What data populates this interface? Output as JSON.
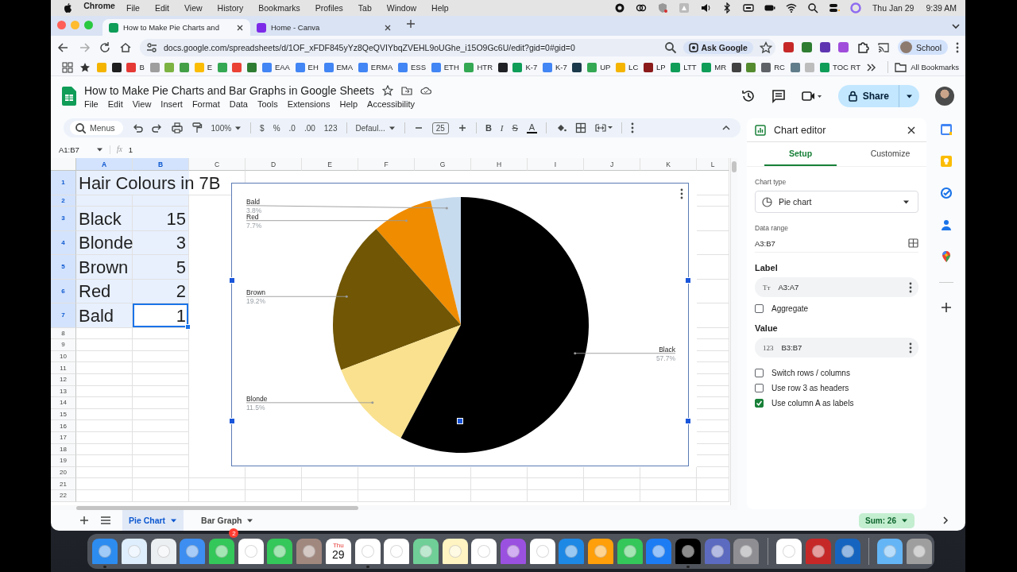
{
  "menubar": {
    "app": "Chrome",
    "items": [
      "File",
      "Edit",
      "View",
      "History",
      "Bookmarks",
      "Profiles",
      "Tab",
      "Window",
      "Help"
    ],
    "date": "Thu Jan 29",
    "time": "9:39 AM"
  },
  "browser_tabs": [
    {
      "title": "How to Make Pie Charts and",
      "selected": true,
      "color": "#0f9d58"
    },
    {
      "title": "Home - Canva",
      "selected": false,
      "color": "#7d2ae8"
    }
  ],
  "address_bar": {
    "url": "docs.google.com/spreadsheets/d/1OF_xFDF845yYz8QeQVIYbqZVEHL9oUGhe_i15O9Gc6U/edit?gid=0#gid=0",
    "ask": "Ask Google",
    "profile": "School",
    "extensions": [
      {
        "color": "#c62828"
      },
      {
        "color": "#2e7d32"
      },
      {
        "color": "#5e35b1"
      },
      {
        "color": "#a04ddb"
      }
    ]
  },
  "bookmarks": {
    "items": [
      {
        "color": "#f4b400"
      },
      {
        "color": "#1f1f1f"
      },
      {
        "label": "B",
        "color": "#e53935"
      },
      {
        "color": "#9e9e9e"
      },
      {
        "color": "#7cb342"
      },
      {
        "color": "#43a047"
      },
      {
        "label": "E",
        "color": "#fbbc04"
      },
      {
        "color": "#34a853"
      },
      {
        "color": "#ea4335"
      },
      {
        "color": "#2e7d32"
      },
      {
        "label": "EAA",
        "color": "#4285f4"
      },
      {
        "label": "EH",
        "color": "#4285f4"
      },
      {
        "label": "EMA",
        "color": "#4285f4"
      },
      {
        "label": "ERMA",
        "color": "#4285f4"
      },
      {
        "label": "ESS",
        "color": "#4285f4"
      },
      {
        "label": "ETH",
        "color": "#4285f4"
      },
      {
        "label": "HTR",
        "color": "#34a853"
      },
      {
        "color": "#202124"
      },
      {
        "label": "K-7",
        "color": "#0f9d58"
      },
      {
        "label": "K-7",
        "color": "#4285f4"
      },
      {
        "color": "#1b3a4b"
      },
      {
        "label": "UP",
        "color": "#34a853"
      },
      {
        "label": "LC",
        "color": "#f4b400"
      },
      {
        "label": "LP",
        "color": "#8b1a1a"
      },
      {
        "label": "LTT",
        "color": "#0f9d58"
      },
      {
        "label": "MR",
        "color": "#0f9d58"
      },
      {
        "color": "#424242"
      },
      {
        "color": "#558b2f"
      },
      {
        "label": "RC",
        "color": "#5f6368"
      },
      {
        "color": "#607d8b"
      },
      {
        "color": "#bdbdbd"
      },
      {
        "label": "TOC RT",
        "color": "#0f9d58"
      }
    ],
    "all": "All Bookmarks"
  },
  "doc": {
    "title": "How to Make Pie Charts and Bar Graphs in Google Sheets",
    "menus": [
      "File",
      "Edit",
      "View",
      "Insert",
      "Format",
      "Data",
      "Tools",
      "Extensions",
      "Help",
      "Accessibility"
    ],
    "share": "Share"
  },
  "toolbar": {
    "search": "Menus",
    "zoom": "100%",
    "currency": "$",
    "percent": "%",
    "decrease_decimals": ".0",
    "increase_decimals": ".00",
    "number_format": "123",
    "font": "Defaul...",
    "font_size": "25",
    "bold": "B",
    "italic": "I",
    "strikethrough": "S",
    "text_color": "A"
  },
  "formula_bar": {
    "name_box": "A1:B7",
    "fx": "fx",
    "value": "1"
  },
  "grid": {
    "columns": [
      {
        "label": "A",
        "selected": true
      },
      {
        "label": "B",
        "selected": true
      },
      {
        "label": "C",
        "selected": false
      },
      {
        "label": "D",
        "selected": false
      },
      {
        "label": "E",
        "selected": false
      },
      {
        "label": "F",
        "selected": false
      },
      {
        "label": "G",
        "selected": false
      },
      {
        "label": "H",
        "selected": false
      },
      {
        "label": "I",
        "selected": false
      },
      {
        "label": "J",
        "selected": false
      },
      {
        "label": "K",
        "selected": false
      },
      {
        "label": "L",
        "selected": false
      }
    ],
    "rows": [
      {
        "label": "1",
        "selected": true,
        "cells": [
          {
            "text": "Hair Colours in 7B",
            "active": false
          }
        ]
      },
      {
        "label": "2",
        "selected": true
      },
      {
        "label": "3",
        "selected": true,
        "cells": [
          {
            "text": "Black",
            "active": false
          },
          {
            "text": "15",
            "active": false
          }
        ]
      },
      {
        "label": "4",
        "selected": true,
        "cells": [
          {
            "text": "Blonde",
            "active": false
          },
          {
            "text": "3",
            "active": false
          }
        ]
      },
      {
        "label": "5",
        "selected": true,
        "cells": [
          {
            "text": "Brown",
            "active": false
          },
          {
            "text": "5",
            "active": false
          }
        ]
      },
      {
        "label": "6",
        "selected": true,
        "cells": [
          {
            "text": "Red",
            "active": false
          },
          {
            "text": "2",
            "active": false
          }
        ]
      },
      {
        "label": "7",
        "selected": true,
        "cells": [
          {
            "text": "Bald",
            "active": false
          },
          {
            "text": "1",
            "active": true
          }
        ]
      },
      {
        "label": "8",
        "selected": false
      },
      {
        "label": "9",
        "selected": false
      },
      {
        "label": "10",
        "selected": false
      },
      {
        "label": "11",
        "selected": false
      },
      {
        "label": "12",
        "selected": false
      },
      {
        "label": "13",
        "selected": false
      },
      {
        "label": "14",
        "selected": false
      },
      {
        "label": "15",
        "selected": false
      },
      {
        "label": "16",
        "selected": false
      },
      {
        "label": "17",
        "selected": false
      },
      {
        "label": "18",
        "selected": false
      },
      {
        "label": "19",
        "selected": false
      },
      {
        "label": "20",
        "selected": false
      },
      {
        "label": "21",
        "selected": false
      },
      {
        "label": "22",
        "selected": false
      }
    ]
  },
  "chart": {
    "chart_data": {
      "type": "pie",
      "categories": [
        "Bald",
        "Red",
        "Brown",
        "Blonde",
        "Black"
      ],
      "values": [
        3.8,
        7.7,
        19.2,
        11.5,
        57.7
      ]
    },
    "slices": [
      {
        "percent": "3.8%",
        "color": "#c7dbee"
      },
      {
        "percent": "7.7%",
        "color": "#f08c00"
      },
      {
        "percent": "19.2%",
        "color": "#705605"
      },
      {
        "percent": "11.5%",
        "color": "#f9e18f"
      },
      {
        "percent": "57.7%",
        "color": "#000000"
      }
    ]
  },
  "chart_editor": {
    "title": "Chart editor",
    "tabs": [
      {
        "label": "Setup",
        "selected": true
      },
      {
        "label": "Customize",
        "selected": false
      }
    ],
    "chart_type_label": "Chart type",
    "chart_type": "Pie chart",
    "data_range_label": "Data range",
    "data_range": "A3:B7",
    "label_heading": "Label",
    "label_chip": {
      "icon": "Tт",
      "range": "A3:A7"
    },
    "aggregate": {
      "label": "Aggregate",
      "checked": false
    },
    "value_heading": "Value",
    "value_chip": {
      "icon": "123",
      "range": "B3:B7"
    },
    "options": [
      {
        "label": "Switch rows / columns",
        "checked": false
      },
      {
        "label": "Use row 3 as headers",
        "checked": false
      },
      {
        "label": "Use column A as labels",
        "checked": true
      }
    ]
  },
  "sheet_tabs": [
    {
      "label": "Pie Chart",
      "selected": true
    },
    {
      "label": "Bar Graph",
      "selected": false
    }
  ],
  "sum": "Sum: 26",
  "dock": {
    "apps": [
      {
        "color": "#2d8cf0",
        "running": true
      },
      {
        "color": "#dfeefc",
        "running": false
      },
      {
        "color": "#eceff1",
        "running": false
      },
      {
        "color": "#3d8ef0",
        "running": false
      },
      {
        "color": "#34c759",
        "running": false,
        "badge": "2"
      },
      {
        "color": "#ffffff",
        "running": false
      },
      {
        "color": "#34c759",
        "running": false
      },
      {
        "color": "#a1887f",
        "running": false
      },
      {
        "color": "#ffffff",
        "running": false,
        "day": "Thu",
        "date": "29"
      },
      {
        "color": "#ffffff",
        "running": true
      },
      {
        "color": "#ffffff",
        "running": false
      },
      {
        "color": "#6fcf97",
        "running": false
      },
      {
        "color": "#fff4c2",
        "running": false
      },
      {
        "color": "#ffffff",
        "running": false
      },
      {
        "color": "#9b51e0",
        "running": false
      },
      {
        "color": "#ffffff",
        "running": false
      },
      {
        "color": "#1e88e5",
        "running": false
      },
      {
        "color": "#ff9f0a",
        "running": false
      },
      {
        "color": "#34c759",
        "running": false
      },
      {
        "color": "#1c7cf4",
        "running": false
      },
      {
        "color": "#000000",
        "running": true
      },
      {
        "color": "#5c6bc0",
        "running": false
      },
      {
        "color": "#8e8e93",
        "running": false
      }
    ],
    "extras": [
      {
        "color": "#ffffff"
      },
      {
        "color": "#c62828"
      },
      {
        "color": "#1565c0"
      }
    ],
    "utilities": [
      {
        "color": "#64b5f6"
      },
      {
        "color": "#9e9e9e"
      }
    ]
  }
}
